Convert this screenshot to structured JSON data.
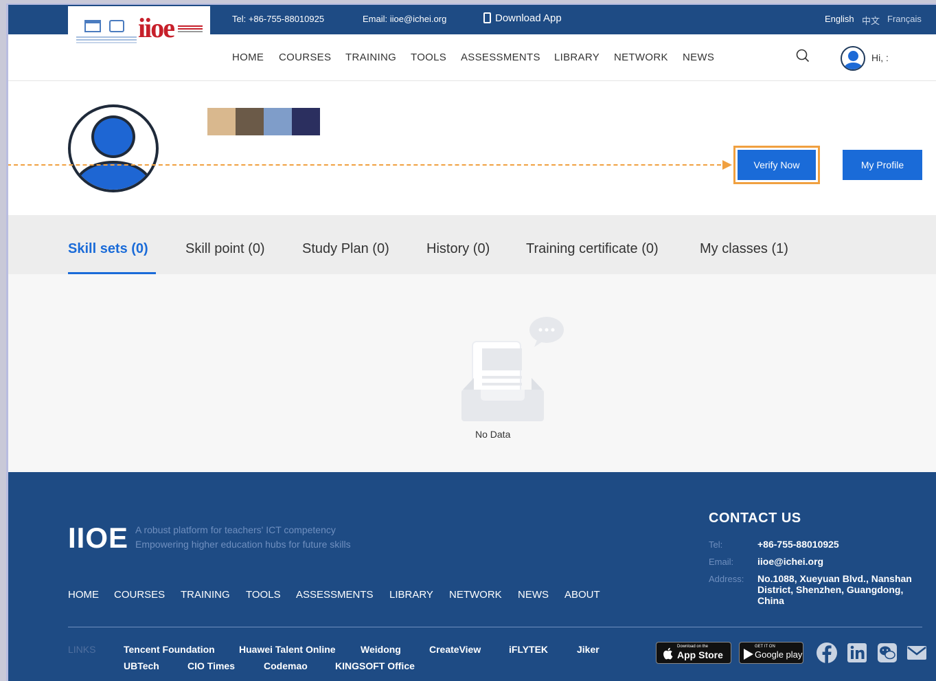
{
  "topbar": {
    "tel": "Tel: +86-755-88010925",
    "email": "Email: iioe@ichei.org",
    "download": "Download App",
    "lang_en": "English",
    "lang_zh": "中文",
    "lang_fr": "Français"
  },
  "logo": {
    "text": "iioe"
  },
  "nav": {
    "items": [
      "HOME",
      "COURSES",
      "TRAINING",
      "TOOLS",
      "ASSESSMENTS",
      "LIBRARY",
      "NETWORK",
      "NEWS"
    ],
    "greeting": "Hi, :"
  },
  "profile": {
    "verify_label": "Verify Now",
    "my_profile_label": "My Profile"
  },
  "tabs": [
    {
      "label": "Skill sets (0)",
      "active": true
    },
    {
      "label": "Skill point (0)"
    },
    {
      "label": "Study Plan (0)"
    },
    {
      "label": "History (0)"
    },
    {
      "label": "Training certificate (0)"
    },
    {
      "label": "My classes (1)"
    }
  ],
  "empty_state": {
    "text": "No Data"
  },
  "footer": {
    "brand": "IIOE",
    "tagline1": "A robust platform for teachers' ICT competency",
    "tagline2": "Empowering higher education hubs for future skills",
    "nav": [
      "HOME",
      "COURSES",
      "TRAINING",
      "TOOLS",
      "ASSESSMENTS",
      "LIBRARY",
      "NETWORK",
      "NEWS",
      "ABOUT"
    ],
    "contact": {
      "title": "CONTACT US",
      "tel_label": "Tel:",
      "tel": "+86-755-88010925",
      "email_label": "Email:",
      "email": "iioe@ichei.org",
      "address_label": "Address:",
      "address": "No.1088, Xueyuan Blvd., Nanshan District, Shenzhen, Guangdong, China"
    },
    "links_label": "LINKS",
    "links_row1": [
      "Tencent Foundation",
      "Huawei Talent Online",
      "Weidong",
      "CreateView",
      "iFLYTEK",
      "Jiker"
    ],
    "links_row2": [
      "UBTech",
      "CIO Times",
      "Codemao",
      "KINGSOFT Office"
    ],
    "app_store": {
      "small": "Download on the",
      "big": "App Store"
    },
    "google_play": {
      "small": "GET IT ON",
      "big": "Google play"
    }
  },
  "colors": {
    "navy": "#1e4b84",
    "accent": "#1a6bd8",
    "highlight": "#f0a040"
  }
}
